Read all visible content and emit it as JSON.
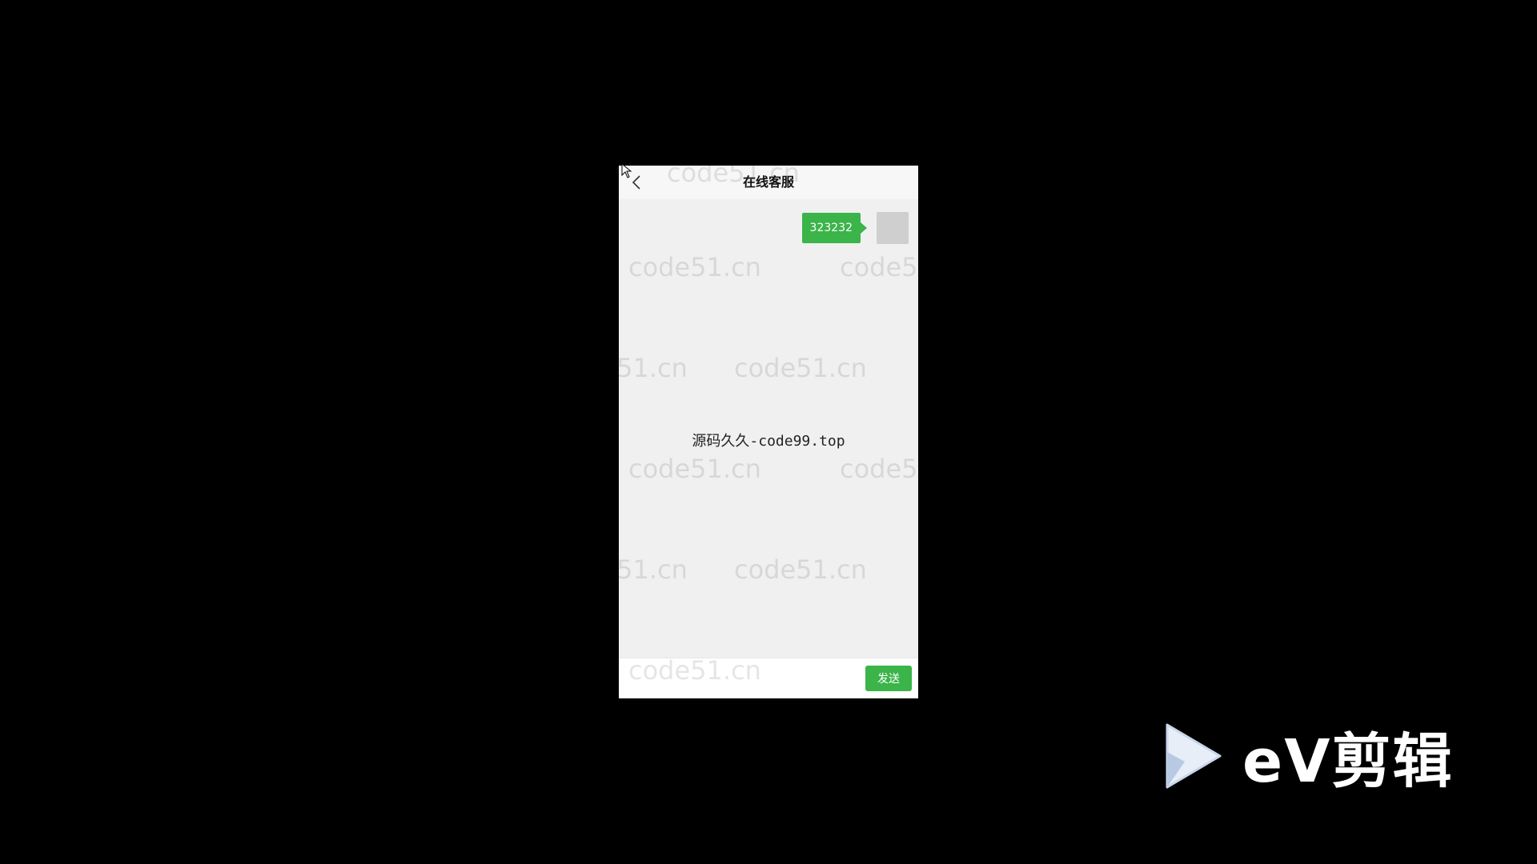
{
  "header": {
    "title": "在线客服"
  },
  "messages": [
    {
      "text": "323232",
      "side": "right"
    }
  ],
  "center_text": "源码久久-code99.top",
  "watermark_text": "code51.cn",
  "footer": {
    "input_value": "",
    "send_label": "发送"
  },
  "overlay_logo": {
    "text": "eV剪辑"
  },
  "colors": {
    "accent": "#3bb44a",
    "chat_bg": "#f0f0f0",
    "header_bg": "#f7f7f7",
    "outer_bg": "#000000"
  }
}
